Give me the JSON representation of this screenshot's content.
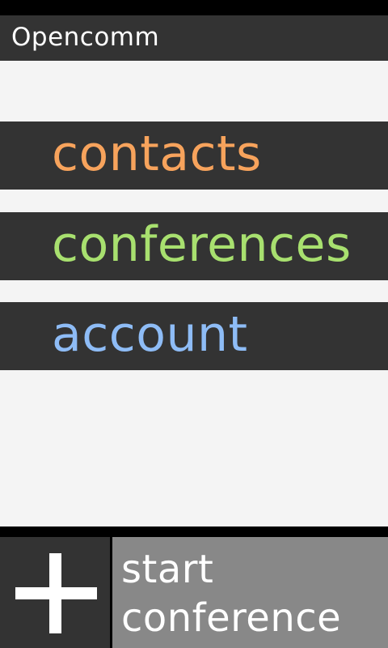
{
  "app": {
    "title": "Opencomm"
  },
  "menu": {
    "items": [
      {
        "label": "contacts",
        "color": "#f7a35c"
      },
      {
        "label": "conferences",
        "color": "#a8e06f"
      },
      {
        "label": "account",
        "color": "#8ebcf6"
      }
    ]
  },
  "actions": {
    "add_icon": "plus-icon",
    "start_conference_label": "start conference"
  },
  "colors": {
    "background": "#f4f4f4",
    "bar": "#333333",
    "button_gray": "#888888"
  }
}
